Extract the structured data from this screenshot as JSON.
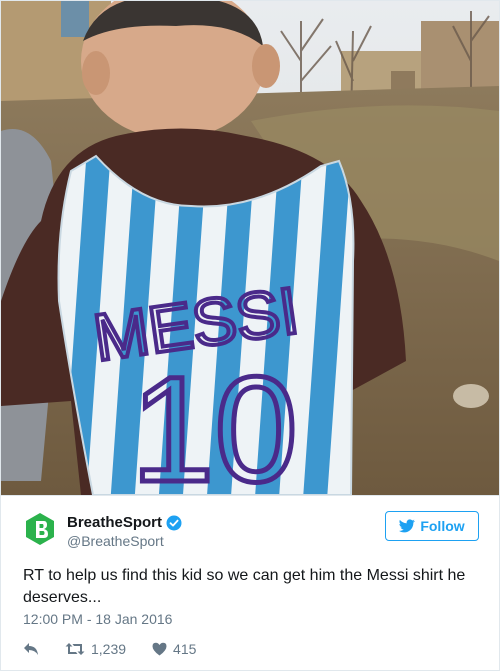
{
  "photo": {
    "alt_icon": "photo-of-child-in-plastic-bag-jersey",
    "shirt_name": "MESSI",
    "shirt_number": "10"
  },
  "account": {
    "display_name": "BreatheSport",
    "handle": "@BreatheSport",
    "avatar_icon": "breathesport-logo-icon",
    "verified_icon": "verified-badge-icon"
  },
  "follow_button": {
    "label": "Follow",
    "icon": "twitter-bird-icon"
  },
  "tweet": {
    "text": "RT to help us find this kid so we can get him the Messi shirt he deserves...",
    "timestamp": "12:00 PM - 18 Jan 2016"
  },
  "actions": {
    "reply_icon": "reply-icon",
    "retweet_icon": "retweet-icon",
    "retweet_count": "1,239",
    "like_icon": "heart-icon",
    "like_count": "415"
  },
  "colors": {
    "accent": "#1da1f2",
    "brand_green": "#2bb24c",
    "verified": "#1da1f2",
    "secondary_text": "#657786",
    "jersey_blue": "#3d97cf",
    "marker_purple": "#4a2a8a"
  }
}
